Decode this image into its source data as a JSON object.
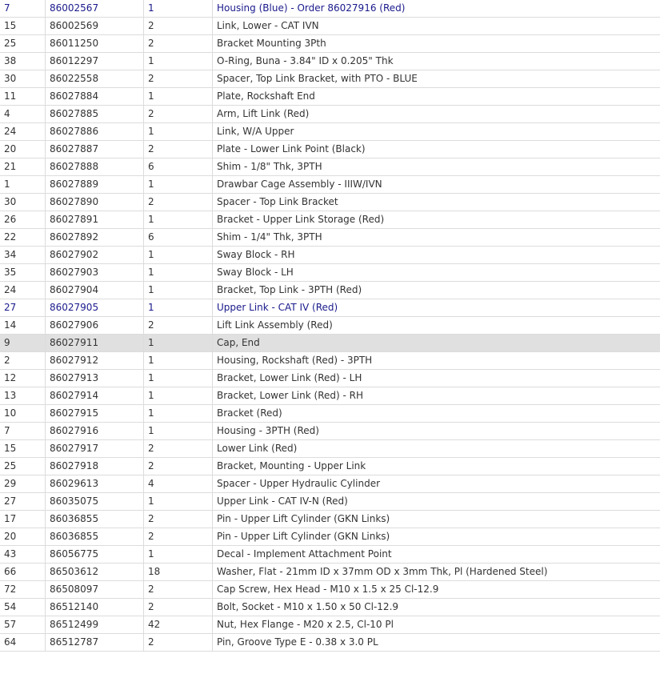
{
  "parts": [
    {
      "ref": "7",
      "part": "86002567",
      "qty": "1",
      "desc": "Housing (Blue) - Order 86027916 (Red)",
      "state": "link"
    },
    {
      "ref": "15",
      "part": "86002569",
      "qty": "2",
      "desc": "Link, Lower - CAT IVN"
    },
    {
      "ref": "25",
      "part": "86011250",
      "qty": "2",
      "desc": "Bracket Mounting 3Pth"
    },
    {
      "ref": "38",
      "part": "86012297",
      "qty": "1",
      "desc": "O-Ring, Buna - 3.84\" ID x 0.205\" Thk"
    },
    {
      "ref": "30",
      "part": "86022558",
      "qty": "2",
      "desc": "Spacer, Top Link Bracket, with PTO - BLUE"
    },
    {
      "ref": "11",
      "part": "86027884",
      "qty": "1",
      "desc": "Plate, Rockshaft End"
    },
    {
      "ref": "4",
      "part": "86027885",
      "qty": "2",
      "desc": "Arm, Lift Link (Red)"
    },
    {
      "ref": "24",
      "part": "86027886",
      "qty": "1",
      "desc": "Link, W/A Upper"
    },
    {
      "ref": "20",
      "part": "86027887",
      "qty": "2",
      "desc": "Plate - Lower Link Point (Black)"
    },
    {
      "ref": "21",
      "part": "86027888",
      "qty": "6",
      "desc": "Shim - 1/8\" Thk, 3PTH"
    },
    {
      "ref": "1",
      "part": "86027889",
      "qty": "1",
      "desc": "Drawbar Cage Assembly - IIIW/IVN"
    },
    {
      "ref": "30",
      "part": "86027890",
      "qty": "2",
      "desc": "Spacer - Top Link Bracket"
    },
    {
      "ref": "26",
      "part": "86027891",
      "qty": "1",
      "desc": "Bracket - Upper Link Storage (Red)"
    },
    {
      "ref": "22",
      "part": "86027892",
      "qty": "6",
      "desc": "Shim - 1/4\" Thk, 3PTH"
    },
    {
      "ref": "34",
      "part": "86027902",
      "qty": "1",
      "desc": "Sway Block - RH"
    },
    {
      "ref": "35",
      "part": "86027903",
      "qty": "1",
      "desc": "Sway Block - LH"
    },
    {
      "ref": "24",
      "part": "86027904",
      "qty": "1",
      "desc": "Bracket, Top Link - 3PTH (Red)"
    },
    {
      "ref": "27",
      "part": "86027905",
      "qty": "1",
      "desc": "Upper Link - CAT IV (Red)",
      "state": "link"
    },
    {
      "ref": "14",
      "part": "86027906",
      "qty": "2",
      "desc": "Lift Link Assembly (Red)"
    },
    {
      "ref": "9",
      "part": "86027911",
      "qty": "1",
      "desc": "Cap, End",
      "state": "selected"
    },
    {
      "ref": "2",
      "part": "86027912",
      "qty": "1",
      "desc": "Housing, Rockshaft (Red) - 3PTH"
    },
    {
      "ref": "12",
      "part": "86027913",
      "qty": "1",
      "desc": "Bracket, Lower Link (Red) - LH"
    },
    {
      "ref": "13",
      "part": "86027914",
      "qty": "1",
      "desc": "Bracket, Lower Link (Red) - RH"
    },
    {
      "ref": "10",
      "part": "86027915",
      "qty": "1",
      "desc": "Bracket (Red)"
    },
    {
      "ref": "7",
      "part": "86027916",
      "qty": "1",
      "desc": "Housing - 3PTH (Red)"
    },
    {
      "ref": "15",
      "part": "86027917",
      "qty": "2",
      "desc": "Lower Link (Red)"
    },
    {
      "ref": "25",
      "part": "86027918",
      "qty": "2",
      "desc": "Bracket, Mounting - Upper Link"
    },
    {
      "ref": "29",
      "part": "86029613",
      "qty": "4",
      "desc": "Spacer - Upper Hydraulic Cylinder"
    },
    {
      "ref": "27",
      "part": "86035075",
      "qty": "1",
      "desc": "Upper Link - CAT IV-N (Red)"
    },
    {
      "ref": "17",
      "part": "86036855",
      "qty": "2",
      "desc": "Pin - Upper Lift Cylinder (GKN Links)"
    },
    {
      "ref": "20",
      "part": "86036855",
      "qty": "2",
      "desc": "Pin - Upper Lift Cylinder (GKN Links)"
    },
    {
      "ref": "43",
      "part": "86056775",
      "qty": "1",
      "desc": "Decal - Implement Attachment Point"
    },
    {
      "ref": "66",
      "part": "86503612",
      "qty": "18",
      "desc": "Washer, Flat - 21mm ID x 37mm OD x 3mm Thk, Pl (Hardened Steel)"
    },
    {
      "ref": "72",
      "part": "86508097",
      "qty": "2",
      "desc": "Cap Screw, Hex Head - M10 x 1.5 x 25 Cl-12.9"
    },
    {
      "ref": "54",
      "part": "86512140",
      "qty": "2",
      "desc": "Bolt, Socket - M10 x 1.50 x 50 Cl-12.9"
    },
    {
      "ref": "57",
      "part": "86512499",
      "qty": "42",
      "desc": "Nut, Hex Flange - M20 x 2.5, Cl-10 Pl"
    },
    {
      "ref": "64",
      "part": "86512787",
      "qty": "2",
      "desc": "Pin, Groove Type E - 0.38 x 3.0 PL"
    }
  ]
}
